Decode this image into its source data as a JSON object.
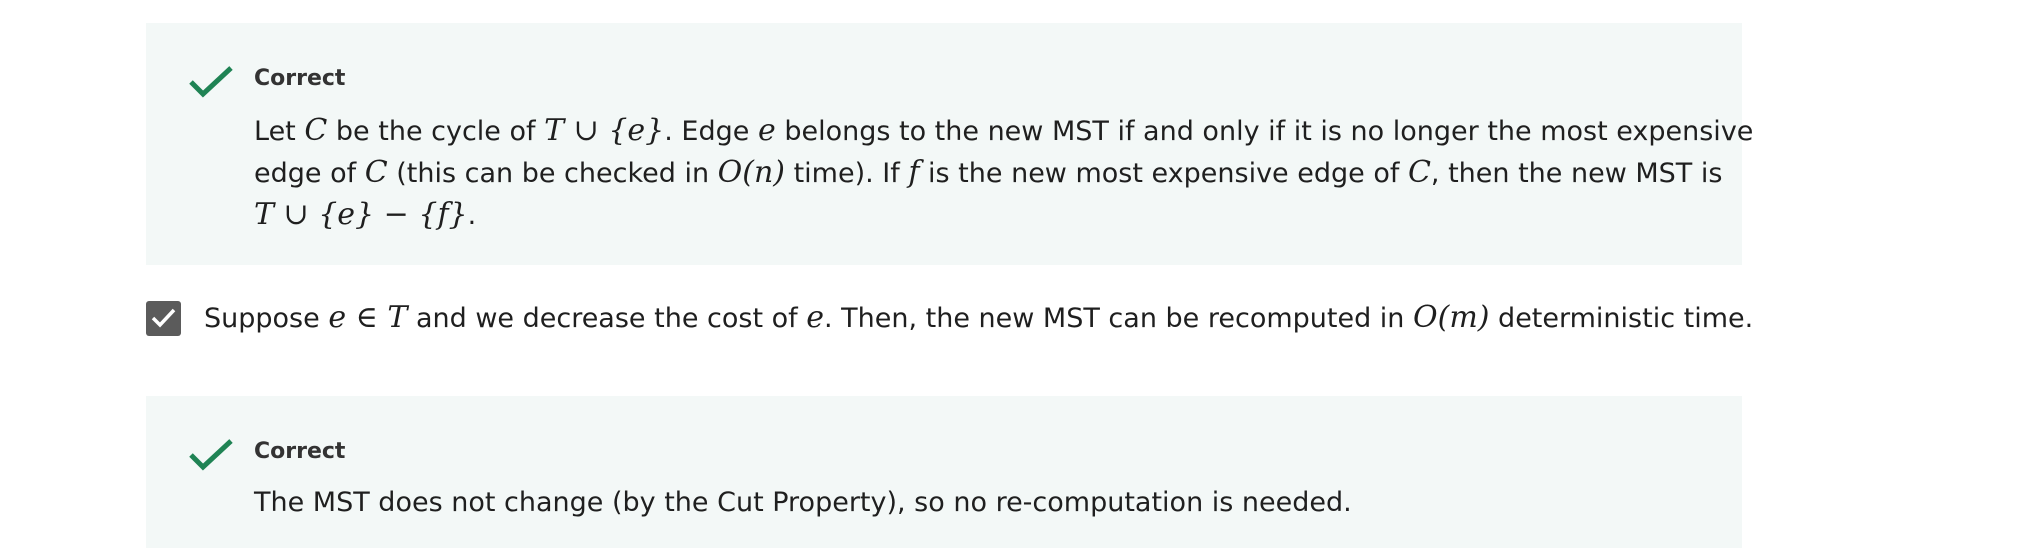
{
  "feedback_1": {
    "title": "Correct",
    "line1_a": "Let ",
    "line1_C": "C",
    "line1_b": " be the cycle of ",
    "line1_expr": "T ∪ {e}",
    "line1_c": ". Edge ",
    "line1_e": "e",
    "line1_d": " belongs to the new MST if and only if it is no longer the most expensive",
    "line2_a": "edge of ",
    "line2_C": "C",
    "line2_b": " (this can be checked in ",
    "line2_expr": "O(n)",
    "line2_c": " time). If ",
    "line2_f": "f",
    "line2_d": " is the new most expensive edge of ",
    "line2_C2": "C",
    "line2_e": ", then the new MST is",
    "line3_expr": "T ∪ {e} − {f}",
    "line3_end": "."
  },
  "option": {
    "checked": true,
    "text_a": "Suppose ",
    "expr1": "e ∈ T",
    "text_b": " and we decrease the cost of ",
    "e": "e",
    "text_c": ". Then, the new MST can be recomputed in ",
    "expr2": "O(m)",
    "text_d": " deterministic time."
  },
  "feedback_2": {
    "title": "Correct",
    "body": "The MST does not change (by the Cut Property), so no re-computation is needed."
  },
  "colors": {
    "check_green": "#1f8354",
    "panel_bg": "#f3f8f7",
    "checkbox_bg": "#5b5b5b"
  }
}
